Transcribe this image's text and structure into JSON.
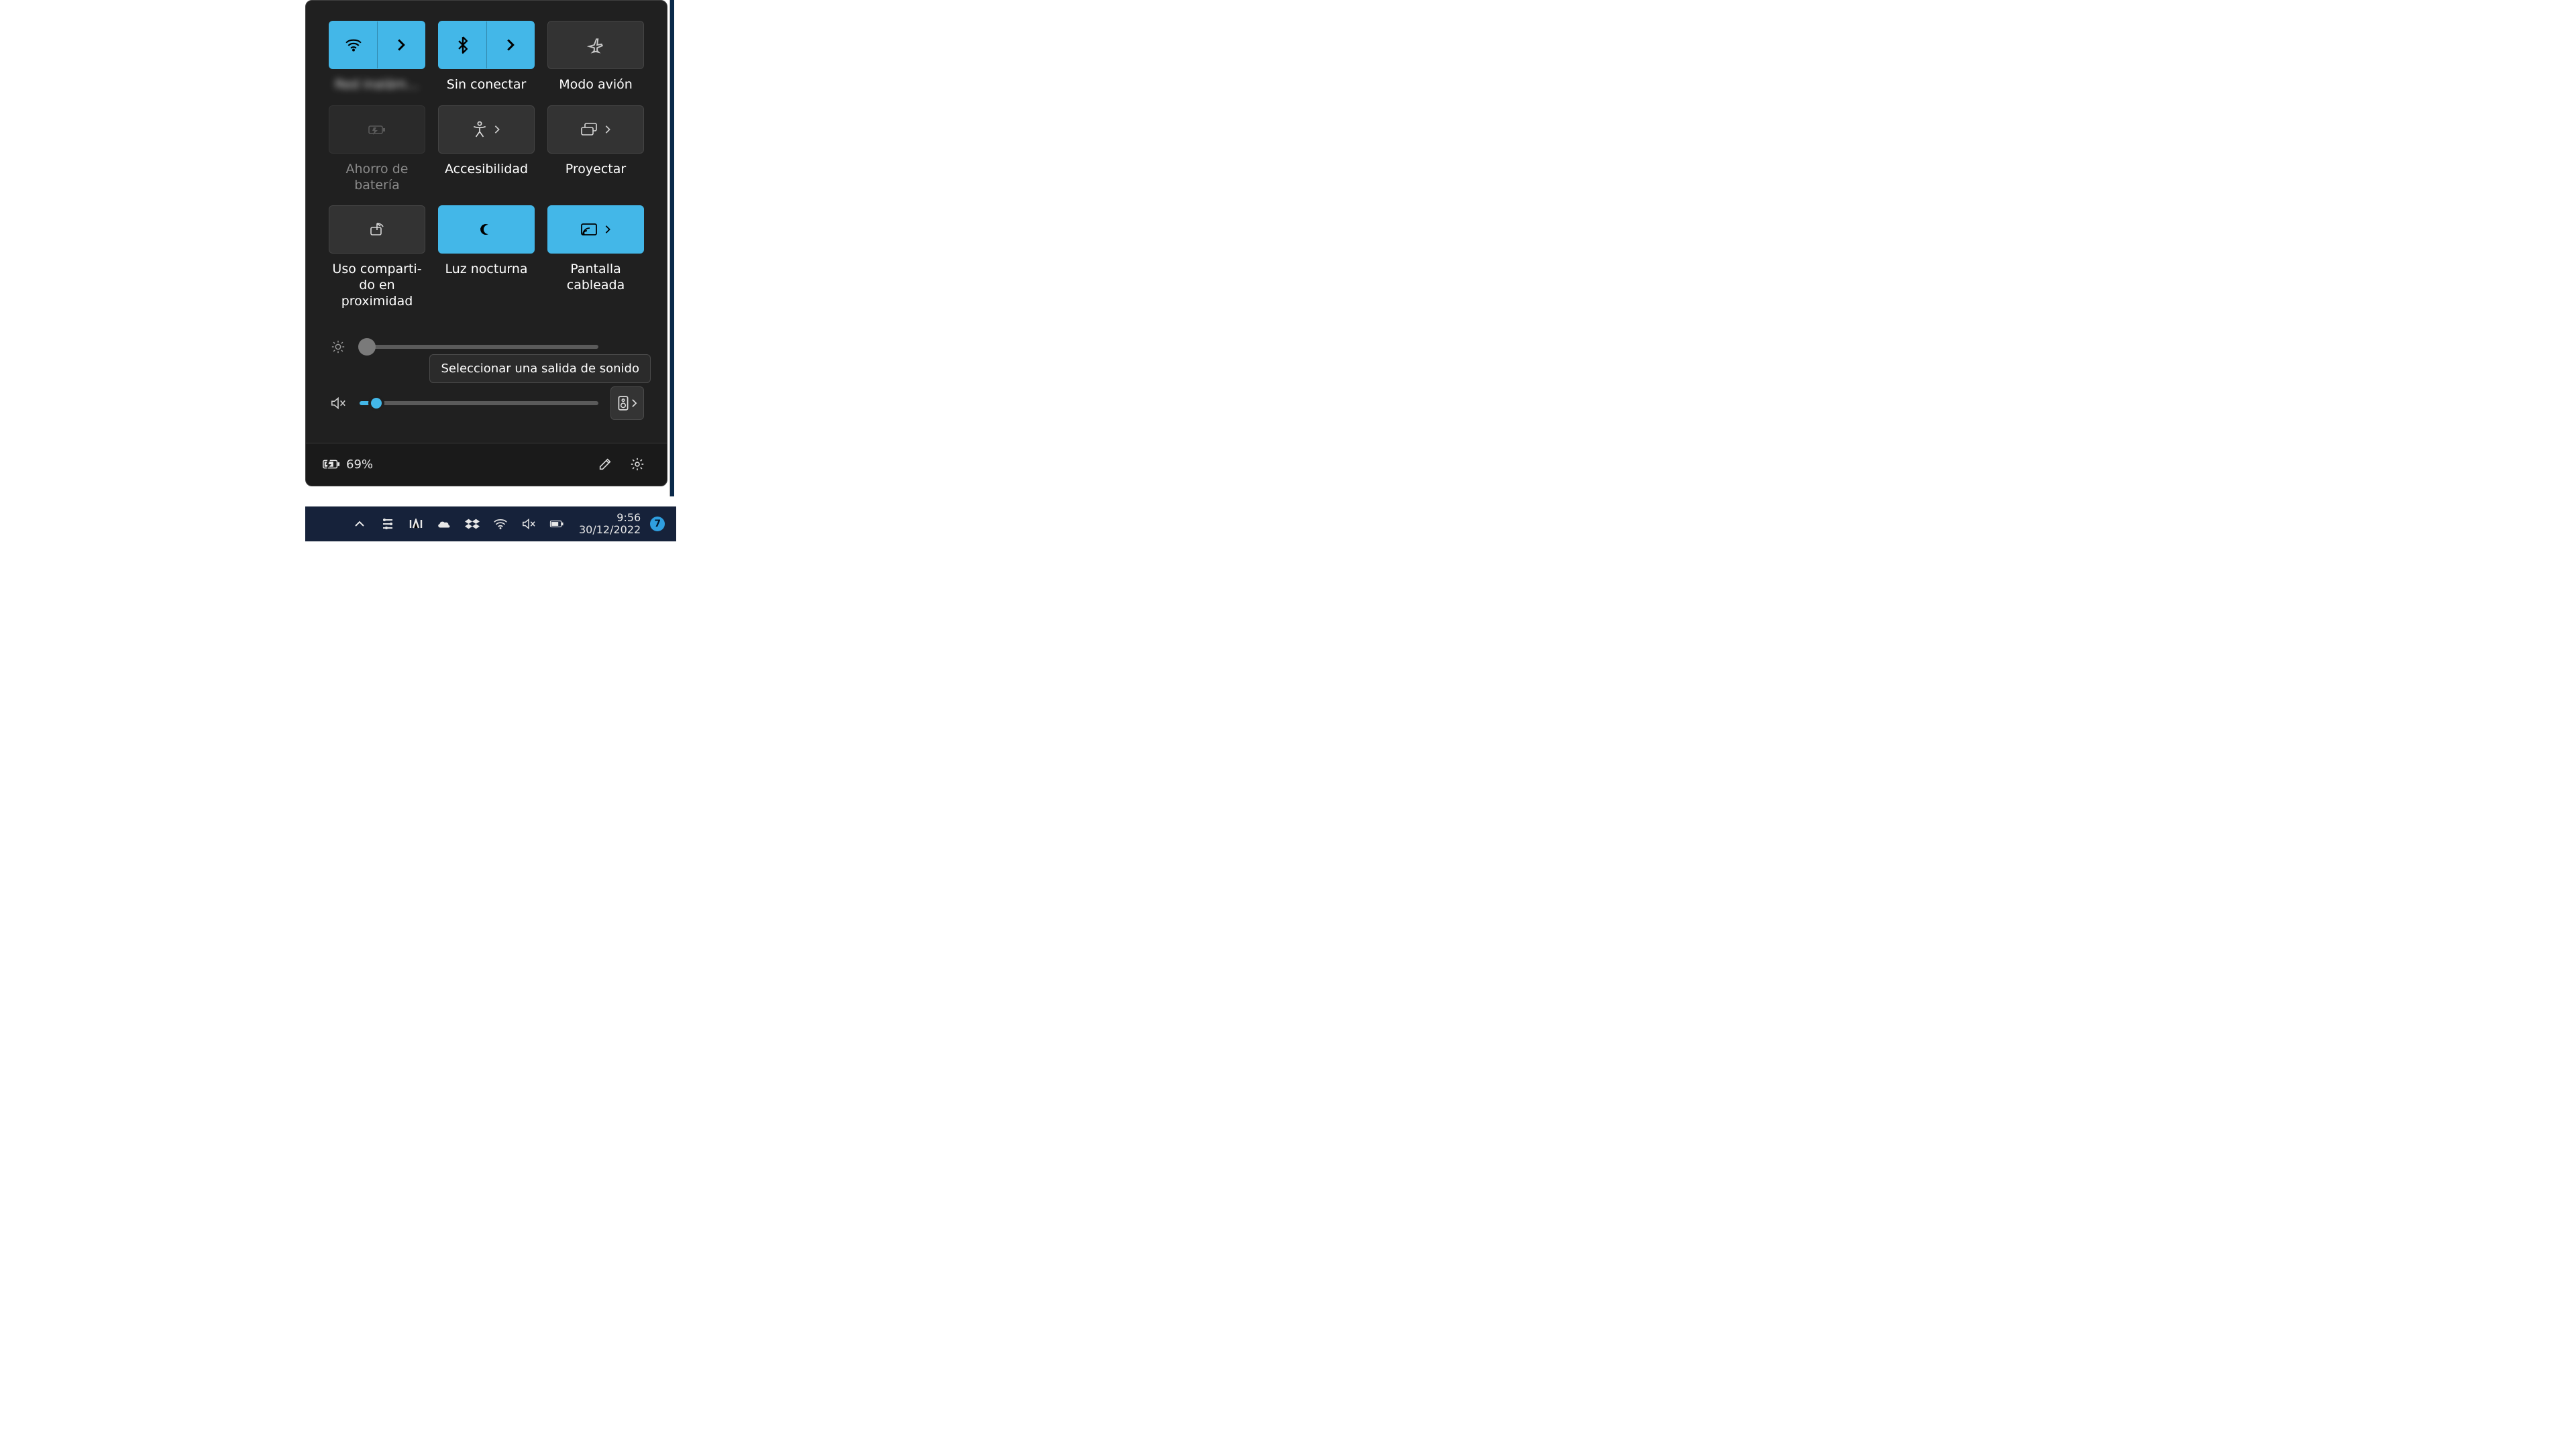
{
  "colors": {
    "accent": "#43b7e8",
    "panel": "#202020"
  },
  "tiles": {
    "wifi": {
      "label": "Red inalám…",
      "active": true,
      "split": true
    },
    "bluetooth": {
      "label": "Sin conectar",
      "active": true,
      "split": true
    },
    "airplane": {
      "label": "Modo avión",
      "active": false,
      "split": false
    },
    "battery_saver": {
      "label": "Ahorro de batería",
      "active": false,
      "disabled": true
    },
    "accessibility": {
      "label": "Accesibilidad",
      "active": false,
      "chevron": true
    },
    "project": {
      "label": "Proyectar",
      "active": false,
      "chevron": true
    },
    "nearby_share": {
      "label": "Uso comparti-\ndo en proximidad",
      "active": false
    },
    "night_light": {
      "label": "Luz nocturna",
      "active": true
    },
    "cast": {
      "label": "Pantalla cableada",
      "active": true,
      "chevron": true
    }
  },
  "sliders": {
    "brightness": {
      "percent": 3
    },
    "volume": {
      "percent": 7,
      "muted": true
    }
  },
  "tooltip": "Seleccionar una salida de sonido",
  "footer": {
    "battery_text": "69%"
  },
  "taskbar": {
    "time": "9:56",
    "date": "30/12/2022",
    "notifications": "7"
  }
}
